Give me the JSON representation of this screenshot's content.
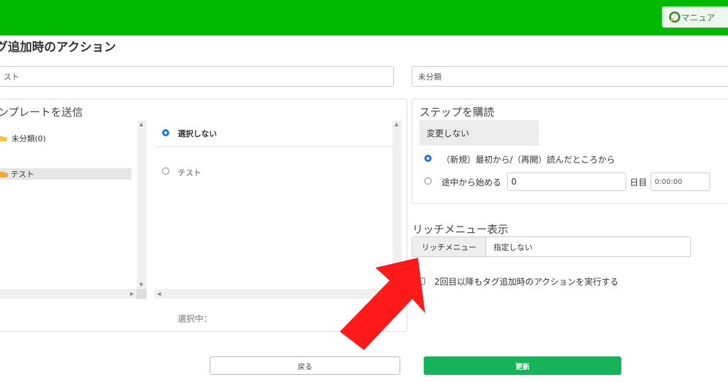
{
  "header": {
    "manual_label": "マニュア"
  },
  "page_title": "グ追加時のアクション",
  "tag_name": {
    "value": "スト"
  },
  "category": {
    "value": "未分類"
  },
  "template": {
    "title": "ンプレートを送信",
    "folders": [
      {
        "label": "未分類(0)"
      },
      {
        "label": "テスト"
      }
    ],
    "options": [
      {
        "label": "選択しない",
        "selected": true
      },
      {
        "label": "テスト",
        "selected": false
      }
    ],
    "selected_label": "選択中："
  },
  "step": {
    "title": "ステップを購読",
    "select_value": "変更しない",
    "option_from_start": "（新規）最初から/（再開）読んだところから",
    "option_from_middle": "途中から始める",
    "day_value": "0",
    "day_unit": "日目",
    "time_value": "0:00:00"
  },
  "rich_menu": {
    "title": "リッチメニュー表示",
    "addon_label": "リッチメニュー",
    "value": "指定しない"
  },
  "repeat_checkbox_label": "2回目以降もタグ追加時のアクションを実行する",
  "buttons": {
    "back": "戻る",
    "update": "更新"
  },
  "colors": {
    "header": "#00b900",
    "accent": "#17b35a",
    "arrow": "#ff1a1a",
    "radio": "#1a73e8"
  }
}
